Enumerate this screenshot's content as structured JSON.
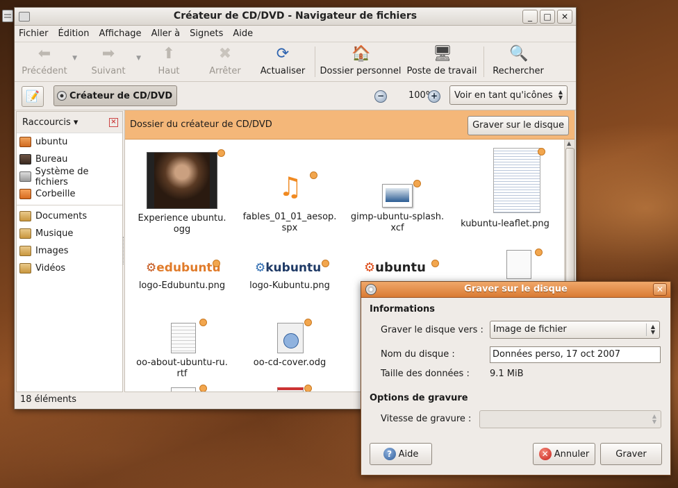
{
  "window": {
    "title": "Créateur de CD/DVD - Navigateur de fichiers",
    "controls": [
      "_",
      "□",
      "✕"
    ]
  },
  "menu": [
    "Fichier",
    "Édition",
    "Affichage",
    "Aller à",
    "Signets",
    "Aide"
  ],
  "toolbar": {
    "back": "Précédent",
    "forward": "Suivant",
    "up": "Haut",
    "stop": "Arrêter",
    "reload": "Actualiser",
    "home": "Dossier personnel",
    "computer": "Poste de travail",
    "search": "Rechercher"
  },
  "location": {
    "crumb": "Créateur de CD/DVD",
    "zoom": "100%",
    "view_mode": "Voir en tant qu'icônes"
  },
  "sidebar": {
    "title": "Raccourcis",
    "items": [
      "ubuntu",
      "Bureau",
      "Système de fichiers",
      "Corbeille"
    ],
    "bookmarks": [
      "Documents",
      "Musique",
      "Images",
      "Vidéos"
    ]
  },
  "content": {
    "banner": "Dossier du créateur de CD/DVD",
    "burn_button": "Graver sur le disque",
    "files": [
      {
        "l1": "Experience ubuntu.",
        "l2": "ogg"
      },
      {
        "l1": "fables_01_01_aesop.",
        "l2": "spx"
      },
      {
        "l1": "gimp-ubuntu-splash.",
        "l2": "xcf"
      },
      {
        "l1": "kubuntu-leaflet.png",
        "l2": ""
      },
      {
        "l1": "logo-Edubuntu.png",
        "l2": ""
      },
      {
        "l1": "logo-Kubuntu.png",
        "l2": ""
      },
      {
        "l1": "oo-about-ubuntu-ru.",
        "l2": "rtf"
      },
      {
        "l1": "oo-cd-cover.odg",
        "l2": ""
      }
    ],
    "logos": {
      "edubuntu": "edubuntu",
      "kubuntu": "kubuntu",
      "ubuntu": "ubuntu"
    }
  },
  "status": "18 éléments",
  "dialog": {
    "title": "Graver sur le disque",
    "section_info": "Informations",
    "burn_to_label": "Graver le disque vers :",
    "burn_to_value": "Image de fichier",
    "disc_name_label": "Nom du disque :",
    "disc_name_value": "Données perso, 17 oct 2007",
    "data_size_label": "Taille des données :",
    "data_size_value": "9.1 MiB",
    "section_options": "Options de gravure",
    "speed_label": "Vitesse de gravure :",
    "help": "Aide",
    "cancel": "Annuler",
    "burn": "Graver"
  },
  "colors": {
    "banner": "#f4b779",
    "dialog_title": "#d97a33",
    "accent": "#e07b2a"
  }
}
